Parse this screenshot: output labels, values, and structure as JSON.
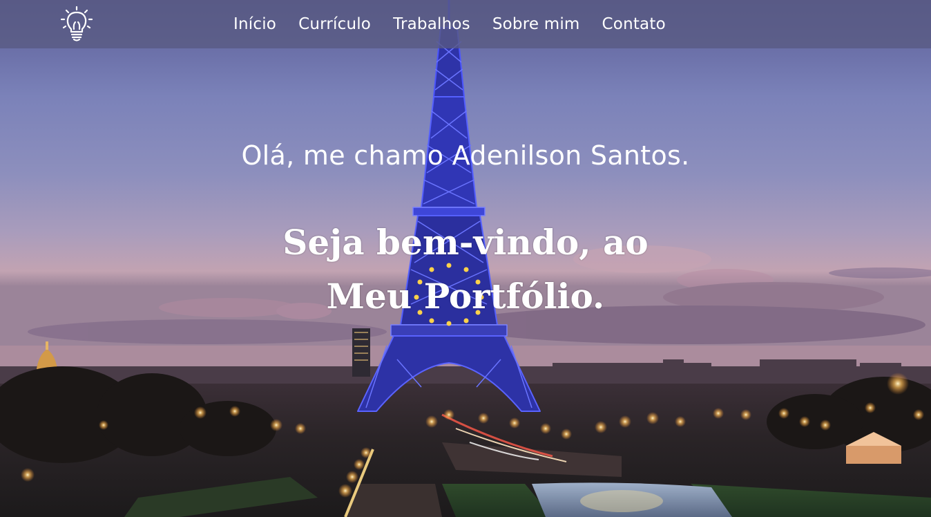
{
  "nav": {
    "logo": "lightbulb-icon",
    "items": [
      {
        "label": "Início"
      },
      {
        "label": "Currículo"
      },
      {
        "label": "Trabalhos"
      },
      {
        "label": "Sobre mim"
      },
      {
        "label": "Contato"
      }
    ]
  },
  "hero": {
    "intro": "Olá, me chamo Adenilson Santos.",
    "title_line1": "Seja bem-vindo, ao",
    "title_line2": "Meu Portfólio."
  },
  "colors": {
    "navbar_bg": "#585a82",
    "sky_top": "#5c5f99",
    "sky_horizon": "#c4a2b4",
    "tower_blue": "#3a40e0",
    "city_lights": "#ffc26a"
  }
}
